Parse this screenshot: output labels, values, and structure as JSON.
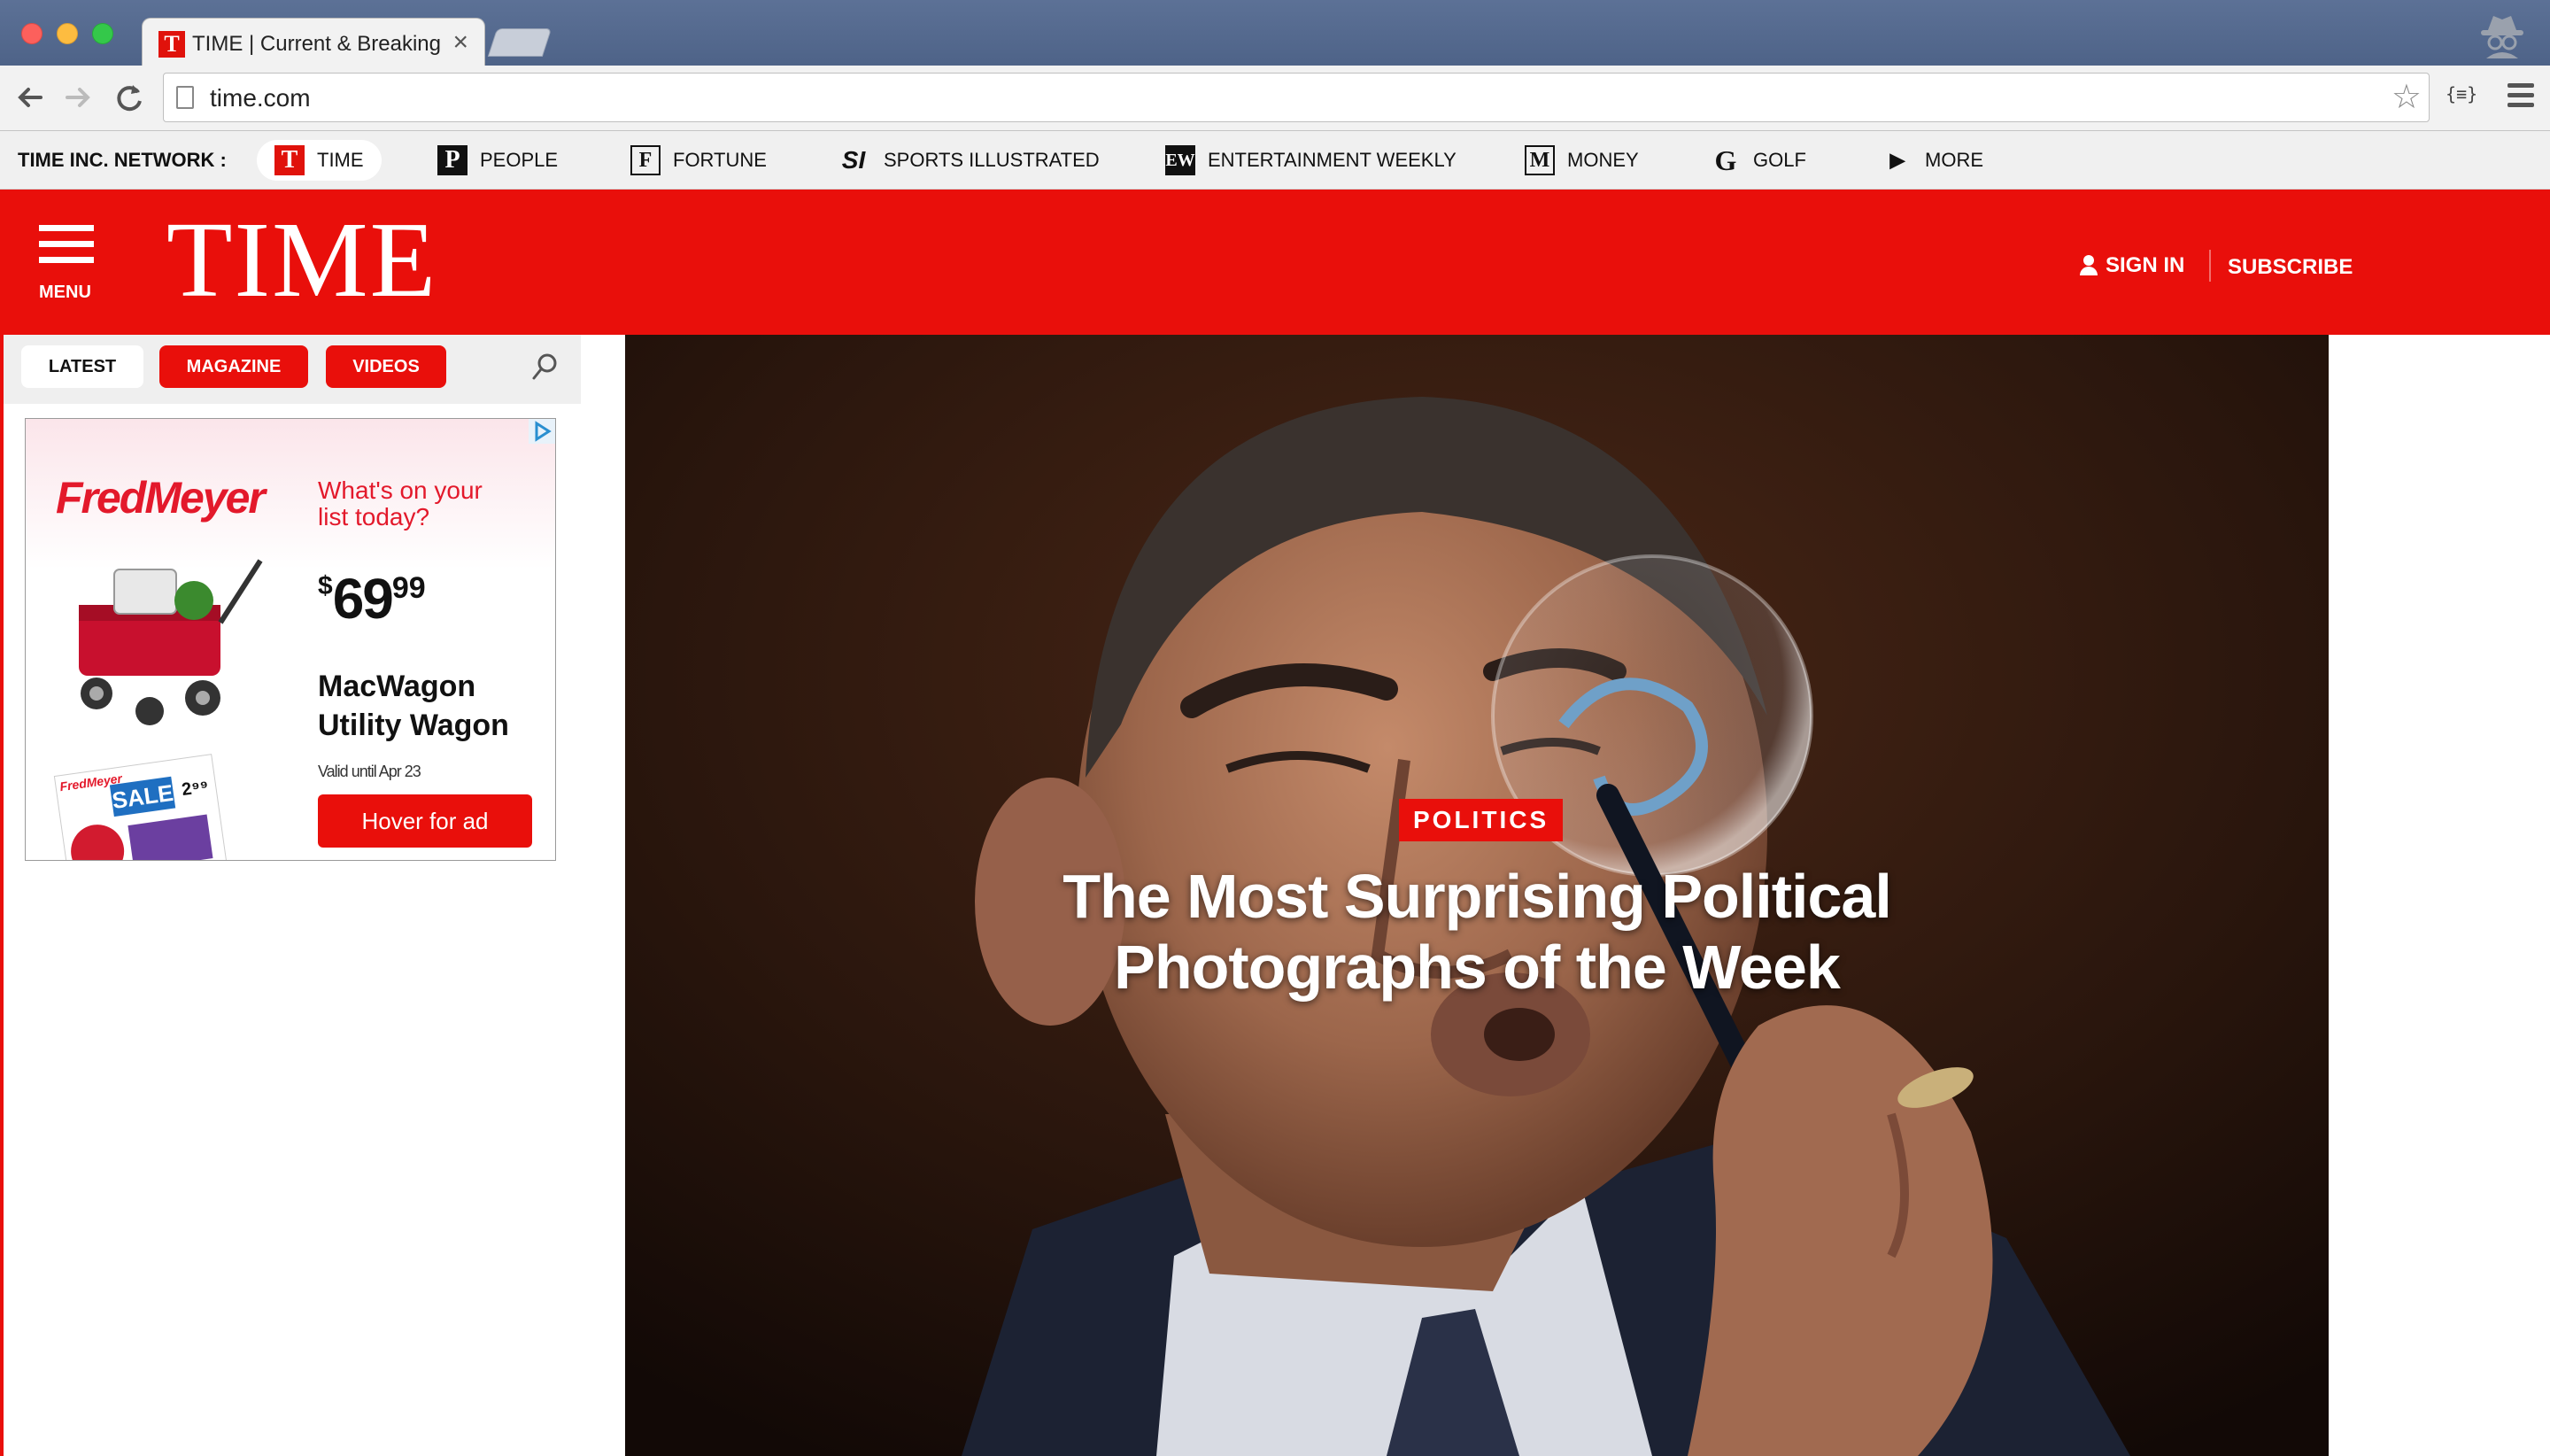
{
  "browser": {
    "tab_title": "TIME | Current & Breaking News",
    "tab_close": "×",
    "url": "time.com",
    "star_glyph": "☆",
    "ext_label": "{≡}"
  },
  "network": {
    "label": "TIME INC. NETWORK :",
    "items": [
      {
        "logo": "T",
        "name": "TIME"
      },
      {
        "logo": "P",
        "name": "PEOPLE"
      },
      {
        "logo": "F",
        "name": "FORTUNE"
      },
      {
        "logo": "SI",
        "name": "SPORTS ILLUSTRATED"
      },
      {
        "logo": "EW",
        "name": "ENTERTAINMENT WEEKLY"
      },
      {
        "logo": "M",
        "name": "MONEY"
      },
      {
        "logo": "G",
        "name": "GOLF"
      },
      {
        "logo": "▶",
        "name": "MORE"
      }
    ]
  },
  "header": {
    "menu_label": "MENU",
    "logo": "TIME",
    "signin": "SIGN IN",
    "subscribe": "SUBSCRIBE",
    "accent_color": "#e90f0b"
  },
  "rail": {
    "tabs": [
      "LATEST",
      "MAGAZINE",
      "VIDEOS"
    ]
  },
  "ad": {
    "brand": "FredMeyer",
    "question": "What's on your list today?",
    "price_currency": "$",
    "price_dollars": "69",
    "price_cents": "99",
    "product": "MacWagon Utility Wagon",
    "valid": "Valid until Apr 23",
    "button": "Hover for ad",
    "flyer_brand": "FredMeyer",
    "flyer_sale": "SALE",
    "flyer_price": "2⁹⁹"
  },
  "hero": {
    "category": "POLITICS",
    "headline": "The Most Surprising Political Photographs of the Week"
  },
  "icons": [
    "back-arrow-icon",
    "forward-arrow-icon",
    "reload-icon",
    "page-icon",
    "star-icon",
    "extension-icon",
    "chrome-menu-icon",
    "incognito-icon",
    "hamburger-icon",
    "person-icon",
    "search-icon",
    "adchoices-icon"
  ]
}
